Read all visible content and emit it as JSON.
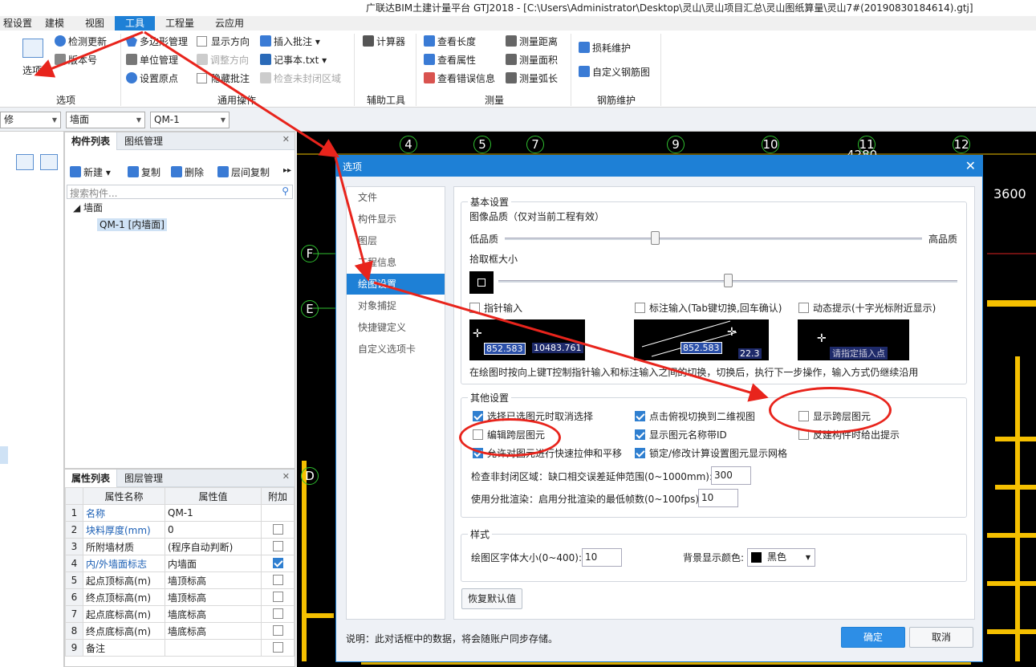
{
  "app": {
    "title": "广联达BIM土建计量平台 GTJ2018 - [C:\\Users\\Administrator\\Desktop\\灵山\\灵山项目汇总\\灵山图纸算量\\灵山7#(20190830184614).gtj]"
  },
  "menu": [
    "程设置",
    "建模",
    "视图",
    "工具",
    "工程量",
    "云应用"
  ],
  "menu_active": "工具",
  "ribbon": {
    "options_label": "选项",
    "check_update": "检测更新",
    "version": "版本号",
    "polygon_mgmt": "多边形管理",
    "unit_mgmt": "单位管理",
    "set_origin": "设置原点",
    "show_direction": "显示方向",
    "adjust_direction": "调整方向",
    "hide_annotation": "隐藏批注",
    "insert_annotation": "插入批注",
    "notepad": "记事本.txt",
    "check_unclosed": "检查未封闭区域",
    "calculator": "计算器",
    "view_length": "查看长度",
    "view_props": "查看属性",
    "view_errors": "查看错误信息",
    "measure_distance": "测量距离",
    "measure_area": "测量面积",
    "measure_arc": "测量弧长",
    "loss_maintenance": "损耗维护",
    "custom_rebar": "自定义钢筋图",
    "groups": [
      "选项",
      "通用操作",
      "辅助工具",
      "测量",
      "钢筋维护"
    ]
  },
  "toolbar2": {
    "combo1": "修",
    "combo2": "墙面",
    "combo3": "QM-1"
  },
  "component_panel": {
    "tabs": [
      "构件列表",
      "图纸管理"
    ],
    "new": "新建",
    "copy": "复制",
    "delete": "删除",
    "floor_copy": "层间复制",
    "search_placeholder": "搜索构件...",
    "tree_root": "墙面",
    "tree_child": "QM-1 [内墙面]"
  },
  "property_panel": {
    "tabs": [
      "属性列表",
      "图层管理"
    ],
    "headers": [
      "属性名称",
      "属性值",
      "附加"
    ],
    "rows": [
      {
        "no": "1",
        "name": "名称",
        "value": "QM-1",
        "blue": true,
        "has_check": false,
        "checked": false
      },
      {
        "no": "2",
        "name": "块料厚度(mm)",
        "value": "0",
        "blue": true,
        "has_check": true,
        "checked": false
      },
      {
        "no": "3",
        "name": "所附墙材质",
        "value": "(程序自动判断)",
        "blue": false,
        "has_check": true,
        "checked": false
      },
      {
        "no": "4",
        "name": "内/外墙面标志",
        "value": "内墙面",
        "blue": true,
        "has_check": true,
        "checked": true
      },
      {
        "no": "5",
        "name": "起点顶标高(m)",
        "value": "墙顶标高",
        "blue": false,
        "has_check": true,
        "checked": false
      },
      {
        "no": "6",
        "name": "终点顶标高(m)",
        "value": "墙顶标高",
        "blue": false,
        "has_check": true,
        "checked": false
      },
      {
        "no": "7",
        "name": "起点底标高(m)",
        "value": "墙底标高",
        "blue": false,
        "has_check": true,
        "checked": false
      },
      {
        "no": "8",
        "name": "终点底标高(m)",
        "value": "墙底标高",
        "blue": false,
        "has_check": true,
        "checked": false
      },
      {
        "no": "9",
        "name": "备注",
        "value": "",
        "blue": false,
        "has_check": true,
        "checked": false
      }
    ]
  },
  "canvas": {
    "axes": [
      "4",
      "5",
      "7",
      "9",
      "10",
      "11",
      "12"
    ],
    "row_axes": [
      "F",
      "E",
      "D"
    ],
    "dim_right": "3600",
    "dim_top": "4280"
  },
  "dialog": {
    "title": "选项",
    "nav": [
      "文件",
      "构件显示",
      "图层",
      "工程信息",
      "绘图设置",
      "对象捕捉",
      "快捷键定义",
      "自定义选项卡"
    ],
    "nav_selected": "绘图设置",
    "basic": {
      "legend": "基本设置",
      "image_quality": "图像品质（仅对当前工程有效）",
      "low": "低品质",
      "high": "高品质",
      "quality_level": 0.36,
      "pick_box": "拾取框大小",
      "pick_level": 0.5,
      "pointer_input": "指针输入",
      "dim_input": "标注输入(Tab键切换,回车确认)",
      "dynamic_hint": "动态提示(十字光标附近显示)",
      "prev1_a": "852.583",
      "prev1_b": "10483.761",
      "prev2_a": "852.583",
      "prev2_b": "22.3",
      "prev3": "请指定插入点",
      "note": "在绘图时按向上键T控制指针输入和标注输入之间的切换，切换后，执行下一步操作，输入方式仍继续沿用"
    },
    "other": {
      "legend": "其他设置",
      "opt1": "选择已选图元时取消选择",
      "opt2": "点击俯视切换到二维视图",
      "opt3": "显示跨层图元",
      "opt4": "编辑跨层图元",
      "opt5": "显示图元名称带ID",
      "opt6": "反建构件时给出提示",
      "opt7": "允许对图元进行快速拉伸和平移",
      "opt8": "锁定/修改计算设置图元显示网格",
      "gap_label": "检查非封闭区域：缺口相交误差延伸范围(0~1000mm):",
      "gap_value": "300",
      "batch_label": "使用分批渲染：启用分批渲染的最低帧数(0~100fps):",
      "batch_value": "10"
    },
    "style": {
      "legend": "样式",
      "font_label": "绘图区字体大小(0~400):",
      "font_value": "10",
      "bg_label": "背景显示颜色:",
      "bg_value": "黑色"
    },
    "restore": "恢复默认值",
    "footer_note": "说明：此对话框中的数据，将会随账户同步存储。",
    "ok": "确定",
    "cancel": "取消"
  },
  "colors": {
    "accent": "#1e80d6",
    "annotation_red": "#e8241c",
    "canvas_bg": "#000000",
    "axis_green": "#2fbf2f",
    "wall_yellow": "#f5c000"
  }
}
